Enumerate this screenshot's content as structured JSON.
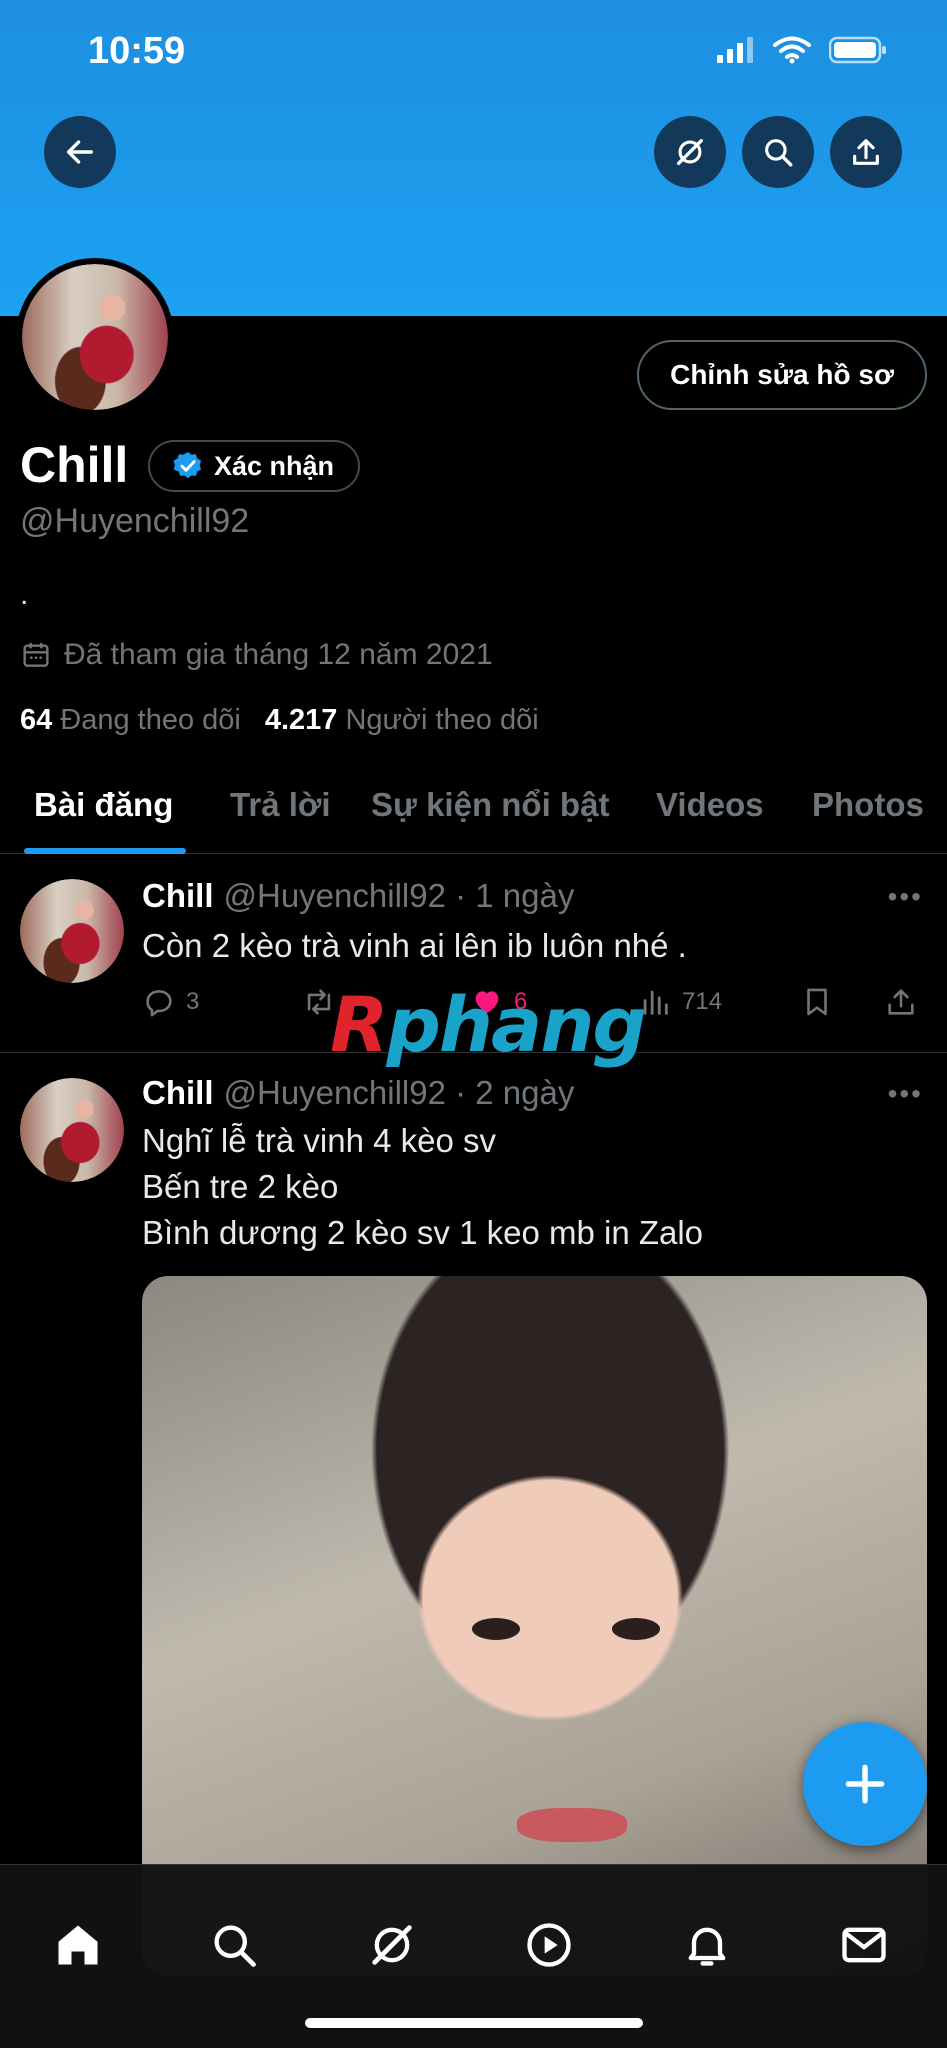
{
  "status_bar": {
    "time": "10:59"
  },
  "profile": {
    "name": "Chill",
    "verified_label": "Xác nhận",
    "handle": "@Huyenchill92",
    "bio": ".",
    "joined": "Đã tham gia tháng 12 năm 2021",
    "following_count": "64",
    "following_label": "Đang theo dõi",
    "followers_count": "4.217",
    "followers_label": "Người theo dõi",
    "edit_label": "Chỉnh sửa hồ sơ"
  },
  "tabs": [
    "Bài đăng",
    "Trả lời",
    "Sự kiện nổi bật",
    "Videos",
    "Photos"
  ],
  "posts": [
    {
      "name": "Chill",
      "handle": "@Huyenchill92",
      "time": "· 1 ngày",
      "lines": [
        "Còn 2 kèo trà vinh ai lên ib luôn nhé ."
      ],
      "replies": "3",
      "likes": "6",
      "views": "714"
    },
    {
      "name": "Chill",
      "handle": "@Huyenchill92",
      "time": "· 2 ngày",
      "lines": [
        "Nghĩ lễ trà vinh 4 kèo sv",
        "Bến tre 2 kèo",
        "Bình dương 2 kèo sv 1 keo mb in Zalo"
      ]
    }
  ],
  "watermark": {
    "r": "R",
    "rest": "phang"
  },
  "colors": {
    "accent": "#1d9bf0",
    "like": "#f91880",
    "banner": "#1da1f2"
  },
  "icons": [
    "back-arrow-icon",
    "grok-icon",
    "search-icon",
    "share-icon",
    "calendar-icon",
    "verified-badge-icon",
    "reply-icon",
    "retweet-icon",
    "heart-icon",
    "views-icon",
    "bookmark-icon",
    "plus-icon",
    "home-icon",
    "bell-icon",
    "mail-icon",
    "play-icon"
  ]
}
